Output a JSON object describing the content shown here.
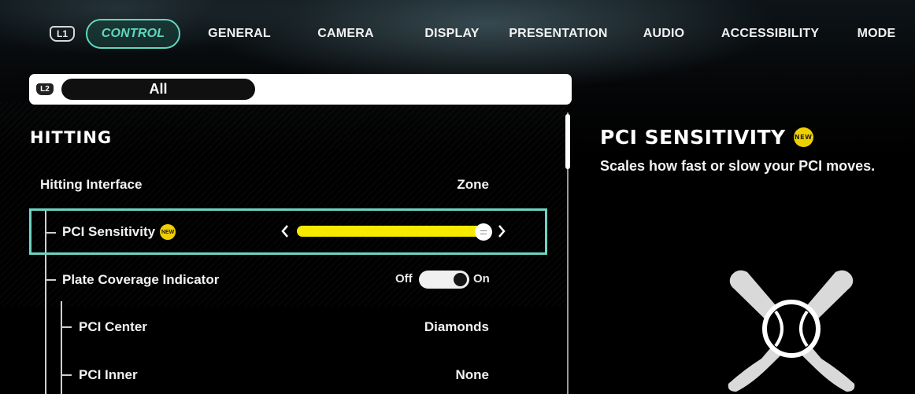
{
  "nav": {
    "l1_label": "L1",
    "tabs": [
      "CONTROL",
      "GENERAL",
      "CAMERA",
      "DISPLAY",
      "PRESENTATION",
      "AUDIO",
      "ACCESSIBILITY",
      "MODE"
    ],
    "active_tab": "CONTROL"
  },
  "filter": {
    "l2_label": "L2",
    "selected": "All"
  },
  "section": {
    "title": "HITTING"
  },
  "settings": [
    {
      "label": "Hitting Interface",
      "value": "Zone"
    },
    {
      "label": "PCI Sensitivity",
      "badge": "NEW",
      "slider_level": 0.97
    },
    {
      "label": "Plate Coverage Indicator",
      "toggle_off": "Off",
      "toggle_on": "On",
      "toggle_state": "On"
    },
    {
      "label": "PCI Center",
      "value": "Diamonds"
    },
    {
      "label": "PCI Inner",
      "value": "None"
    }
  ],
  "detail": {
    "title": "PCI SENSITIVITY",
    "badge": "NEW",
    "description": "Scales how fast or slow your PCI moves."
  },
  "colors": {
    "accent": "#5fd8c0",
    "slider": "#f5ea00",
    "badge": "#f0d000"
  },
  "icons": [
    "chevron-left-icon",
    "chevron-right-icon",
    "new-badge-icon",
    "bats-ball-emblem"
  ]
}
